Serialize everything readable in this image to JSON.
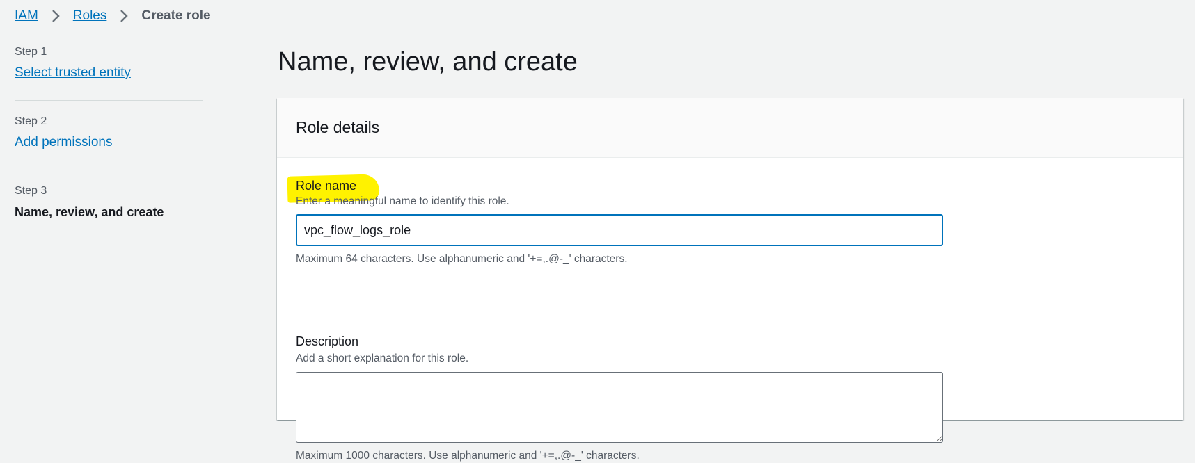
{
  "breadcrumb": {
    "items": [
      {
        "label": "IAM",
        "link": true
      },
      {
        "label": "Roles",
        "link": true
      },
      {
        "label": "Create role",
        "link": false
      }
    ]
  },
  "steps": [
    {
      "step_label": "Step 1",
      "name": "Select trusted entity",
      "current": false
    },
    {
      "step_label": "Step 2",
      "name": "Add permissions",
      "current": false
    },
    {
      "step_label": "Step 3",
      "name": "Name, review, and create",
      "current": true
    }
  ],
  "page": {
    "title": "Name, review, and create"
  },
  "role_details": {
    "title": "Role details",
    "role_name": {
      "label": "Role name",
      "description": "Enter a meaningful name to identify this role.",
      "value": "vpc_flow_logs_role",
      "hint": "Maximum 64 characters. Use alphanumeric and '+=,.@-_' characters."
    },
    "description": {
      "label": "Description",
      "description": "Add a short explanation for this role.",
      "value": "",
      "hint": "Maximum 1000 characters. Use alphanumeric and '+=,.@-_' characters."
    }
  },
  "colors": {
    "link": "#0073bb",
    "highlight": "#fff200",
    "input_focus_border": "#0073bb",
    "background": "#f2f3f3"
  },
  "icons": {
    "breadcrumb_separator": "chevron-right-icon",
    "textarea_resize": "resize-handle-icon"
  }
}
